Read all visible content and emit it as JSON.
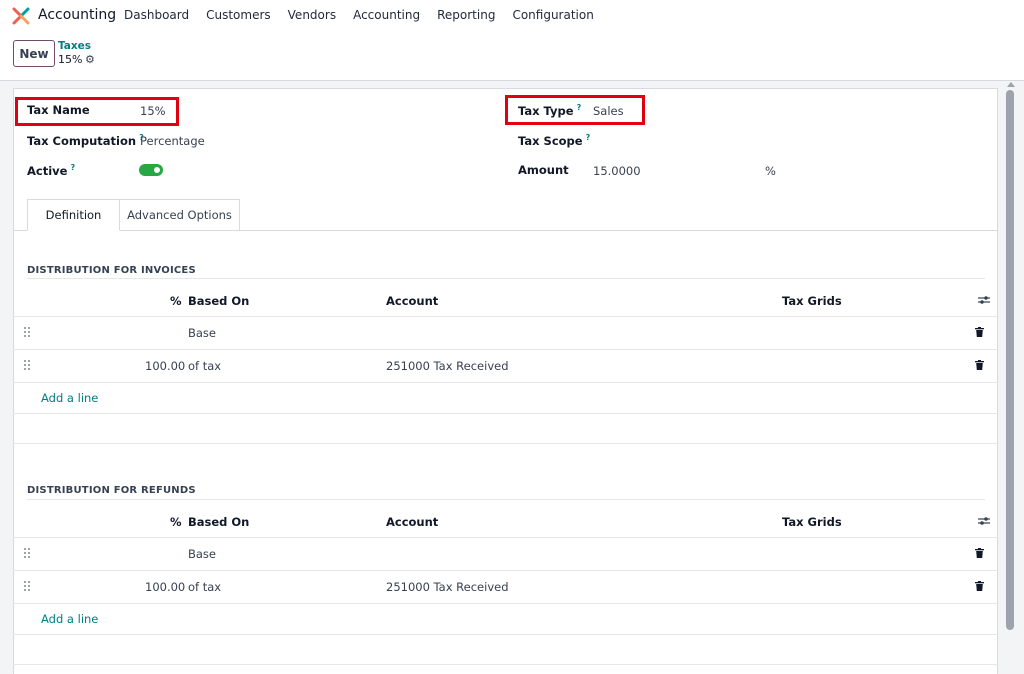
{
  "navbar": {
    "app_name": "Accounting",
    "menu": [
      "Dashboard",
      "Customers",
      "Vendors",
      "Accounting",
      "Reporting",
      "Configuration"
    ]
  },
  "control_panel": {
    "new_label": "New",
    "breadcrumb_parent": "Taxes",
    "breadcrumb_current": "15%",
    "gear_icon": "gear-icon"
  },
  "form": {
    "tax_name": {
      "label": "Tax Name",
      "value": "15%"
    },
    "tax_computation": {
      "label": "Tax Computation",
      "help": "?",
      "value": "Percentage"
    },
    "active": {
      "label": "Active",
      "help": "?",
      "value": true
    },
    "tax_type": {
      "label": "Tax Type",
      "help": "?",
      "value": "Sales"
    },
    "tax_scope": {
      "label": "Tax Scope",
      "help": "?",
      "value": ""
    },
    "amount": {
      "label": "Amount",
      "value": "15.0000",
      "unit": "%"
    },
    "highlight_color": "#e00010",
    "toggle_color": "#28a745"
  },
  "tabs": [
    {
      "label": "Definition",
      "active": true
    },
    {
      "label": "Advanced Options",
      "active": false
    }
  ],
  "invoices": {
    "title": "DISTRIBUTION FOR INVOICES",
    "columns": {
      "percent": "%",
      "based_on": "Based On",
      "account": "Account",
      "tax_grids": "Tax Grids"
    },
    "rows": [
      {
        "percent": "",
        "based_on": "Base",
        "account": "",
        "tax_grids": ""
      },
      {
        "percent": "100.00",
        "based_on": "of tax",
        "account": "251000 Tax Received",
        "tax_grids": ""
      }
    ],
    "add_line": "Add a line"
  },
  "refunds": {
    "title": "DISTRIBUTION FOR REFUNDS",
    "columns": {
      "percent": "%",
      "based_on": "Based On",
      "account": "Account",
      "tax_grids": "Tax Grids"
    },
    "rows": [
      {
        "percent": "",
        "based_on": "Base",
        "account": "",
        "tax_grids": ""
      },
      {
        "percent": "100.00",
        "based_on": "of tax",
        "account": "251000 Tax Received",
        "tax_grids": ""
      }
    ],
    "add_line": "Add a line"
  }
}
